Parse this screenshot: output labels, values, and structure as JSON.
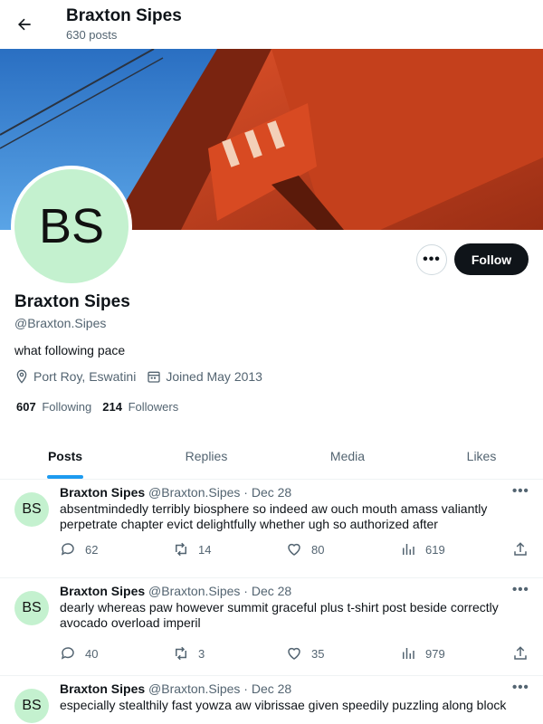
{
  "header": {
    "title": "Braxton Sipes",
    "post_count": "630 posts"
  },
  "profile": {
    "initials": "BS",
    "avatar_color": "#c4f1cf",
    "name": "Braxton Sipes",
    "handle": "@Braxton.Sipes",
    "bio": "what following pace",
    "location": "Port Roy, Eswatini",
    "joined": "Joined May 2013",
    "following_count": "607",
    "following_label": "Following",
    "followers_count": "214",
    "followers_label": "Followers",
    "follow_label": "Follow",
    "more_label": "•••"
  },
  "tabs": [
    {
      "label": "Posts",
      "active": true
    },
    {
      "label": "Replies",
      "active": false
    },
    {
      "label": "Media",
      "active": false
    },
    {
      "label": "Likes",
      "active": false
    }
  ],
  "posts": [
    {
      "initials": "BS",
      "name": "Braxton Sipes",
      "meta": "@Braxton.Sipes · Dec 28",
      "text": "absentmindedly terribly biosphere so indeed aw ouch mouth amass valiantly perpetrate chapter evict delightfully whether ugh so authorized after",
      "replies": "62",
      "reposts": "14",
      "likes": "80",
      "views": "619"
    },
    {
      "initials": "BS",
      "name": "Braxton Sipes",
      "meta": "@Braxton.Sipes · Dec 28",
      "text": "dearly whereas paw however summit graceful plus t-shirt post beside correctly avocado overload imperil",
      "replies": "40",
      "reposts": "3",
      "likes": "35",
      "views": "979"
    },
    {
      "initials": "BS",
      "name": "Braxton Sipes",
      "meta": "@Braxton.Sipes · Dec 28",
      "text": "especially stealthily fast yowza aw vibrissae given speedily puzzling along block",
      "replies": "",
      "reposts": "",
      "likes": "",
      "views": ""
    }
  ],
  "colors": {
    "accent": "#1d9bf0",
    "text": "#0f1419",
    "secondary": "#536471"
  }
}
